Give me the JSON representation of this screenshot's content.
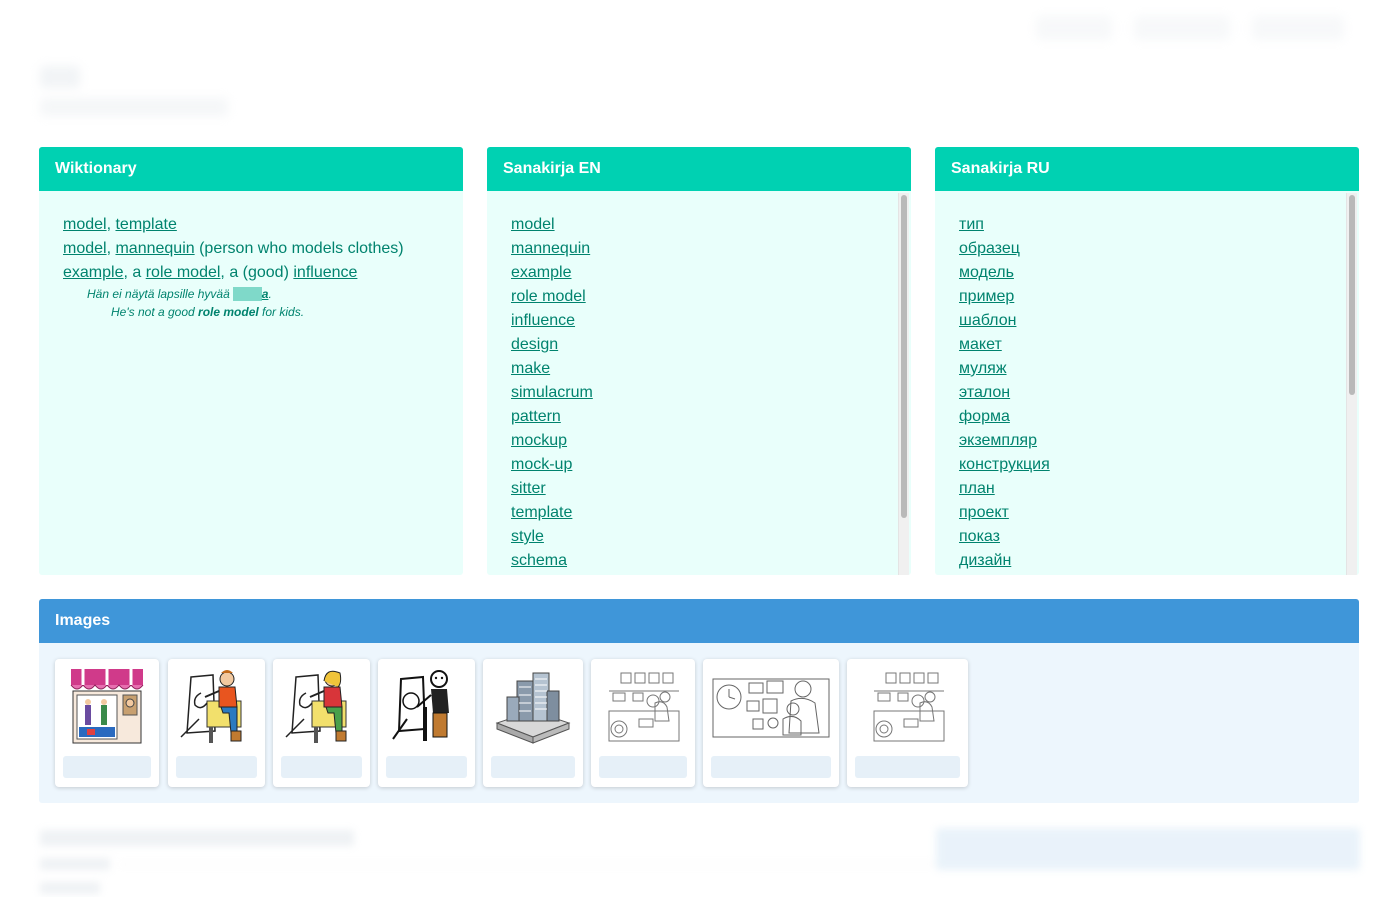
{
  "cards": {
    "wiktionary": {
      "title": "Wiktionary",
      "lines": [
        {
          "w1": "model",
          "s1": ", ",
          "w2": "template"
        },
        {
          "w1": "model",
          "s1": ", ",
          "w2": "mannequin",
          "t": " (person who models clothes)"
        },
        {
          "w1": "example",
          "s1": ", a ",
          "w2": "role model",
          "s2": ", a (good) ",
          "w3": "influence"
        }
      ],
      "example": {
        "fi_pre": "Hän ei näytä lapsille hyvää ",
        "fi_hl": "malli",
        "fi_bold": "a",
        "fi_post": ".",
        "en_pre": "He's not a good ",
        "en_bold": "role model",
        "en_post": " for kids."
      }
    },
    "en": {
      "title": "Sanakirja EN",
      "words": [
        "model",
        "mannequin",
        "example",
        "role model",
        "influence",
        "design",
        "make",
        "simulacrum",
        "pattern",
        "mockup",
        "mock-up",
        "sitter",
        "template",
        "style",
        "schema"
      ]
    },
    "ru": {
      "title": "Sanakirja RU",
      "words": [
        "тип",
        "образец",
        "модель",
        "пример",
        "шаблон",
        "макет",
        "муляж",
        "эталон",
        "форма",
        "экземпляр",
        "конструкция",
        "план",
        "проект",
        "показ",
        "дизайн"
      ]
    }
  },
  "images": {
    "title": "Images",
    "tiles": [
      {
        "icon": "shop-window-icon"
      },
      {
        "icon": "person-drawing-icon"
      },
      {
        "icon": "person-drawing-icon"
      },
      {
        "icon": "person-drawing-icon"
      },
      {
        "icon": "building-model-icon"
      },
      {
        "icon": "kitchen-icon"
      },
      {
        "icon": "clock-wall-icon"
      },
      {
        "icon": "kitchen-icon"
      }
    ]
  },
  "colors": {
    "teal": "#00d1b2",
    "teal_bg": "#e9fffb",
    "link": "#00836e",
    "blue": "#3f96d9",
    "blue_bg": "#edf6fd"
  }
}
